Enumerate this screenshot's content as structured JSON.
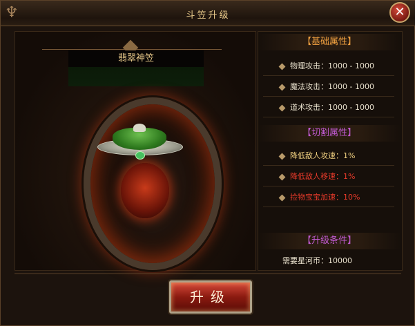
{
  "window": {
    "title": "斗笠升级"
  },
  "item": {
    "name": "翡翠神笠"
  },
  "base_attributes": {
    "header": "【基础属性】",
    "rows": [
      {
        "label": "物理攻击：1000 - 1000"
      },
      {
        "label": "魔法攻击：1000 - 1000"
      },
      {
        "label": "道术攻击：1000 - 1000"
      }
    ]
  },
  "cut_attributes": {
    "header": "【切割属性】",
    "rows": [
      {
        "label": "降低敌人攻速：1%"
      },
      {
        "label": "降低敌人移速：1%"
      },
      {
        "label": "捡物宝宝加速：10%"
      }
    ]
  },
  "upgrade_conditions": {
    "header": "【升级条件】",
    "requirement": "需要星河币：10000"
  },
  "buttons": {
    "upgrade": "升级",
    "close": "✕"
  },
  "colors": {
    "base_header": "#f0a040",
    "cut_header": "#c05ad0",
    "buff_text": "#f0d080",
    "red_text": "#e83a2a"
  }
}
